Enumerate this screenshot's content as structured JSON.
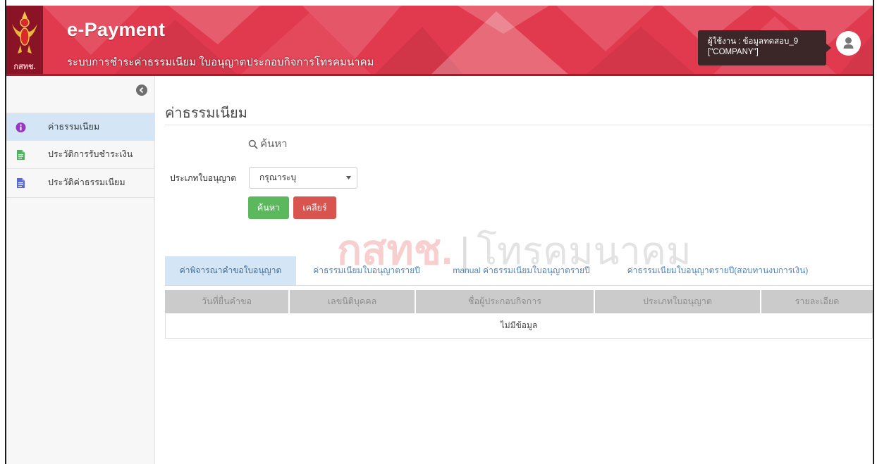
{
  "app": {
    "logo_text": "กสทช.",
    "title": "e-Payment",
    "subtitle": "ระบบการชำระค่าธรรมเนียม ใบอนุญาตประกอบกิจการโทรคมนาคม"
  },
  "user": {
    "name_line": "ผู้ใช้งาน : ข้อมูลทดสอบ_9",
    "role_line": "[\"COMPANY\"]",
    "avatar_icon": "user-icon"
  },
  "sidebar": {
    "toggle_icon": "chevron-left-icon",
    "items": [
      {
        "label": "ค่าธรรมเนียม",
        "icon": "info-icon",
        "icon_color": "#9a35c8",
        "active": true
      },
      {
        "label": "ประวัติการรับชำระเงิน",
        "icon": "document-icon",
        "icon_color": "#4fb35e",
        "active": false
      },
      {
        "label": "ประวัติค่าธรรมเนียม",
        "icon": "document-icon",
        "icon_color": "#5a6bd6",
        "active": false
      }
    ]
  },
  "page": {
    "title": "ค่าธรรมเนียม"
  },
  "search": {
    "icon": "search-icon",
    "heading": "ค้นหา",
    "license_type_label": "ประเภทใบอนุญาต",
    "license_type_value": "กรุณาระบุ",
    "search_button": "ค้นหา",
    "clear_button": "เคลียร์"
  },
  "watermark": {
    "brand": "กสทช.",
    "separator": "|",
    "text": "โทรคมนาคม"
  },
  "tabs": [
    {
      "label": "ค่าพิจารณาคำขอใบอนุญาต",
      "active": true
    },
    {
      "label": "ค่าธรรมเนียมใบอนุญาตรายปี",
      "active": false
    },
    {
      "label": "manual ค่าธรรมเนียมใบอนุญาตรายปี",
      "active": false
    },
    {
      "label": "ค่าธรรมเนียมใบอนุญาตรายปี(สอบทานงบการเงิน)",
      "active": false
    }
  ],
  "table": {
    "columns": [
      "วันที่ยื่นคำขอ",
      "เลขนิติบุคคล",
      "ชื่อผู้ประกอบกิจการ",
      "ประเภทใบอนุญาต",
      "รายละเอียด"
    ],
    "rows": [],
    "empty_text": "ไม่มีข้อมูล"
  },
  "colors": {
    "header": "#e13a4e",
    "active_highlight": "#d4e6f5",
    "search_button": "#5cb85c",
    "clear_button": "#d9534f",
    "table_header": "#cbcbcb"
  }
}
